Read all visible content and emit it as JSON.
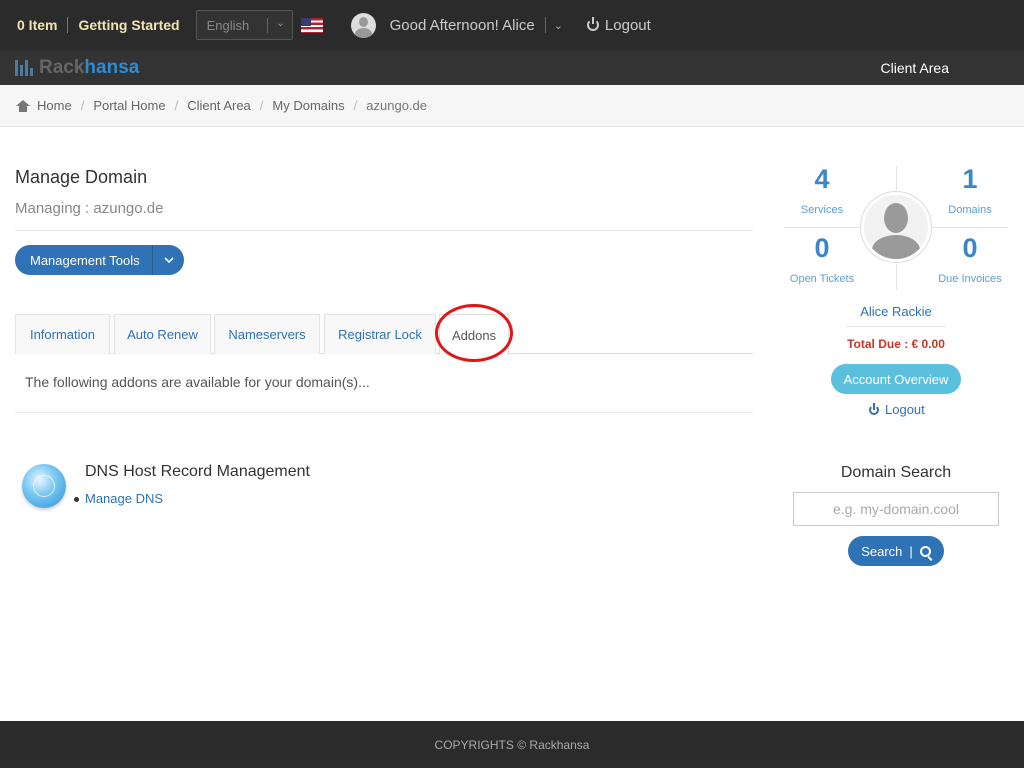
{
  "topbar": {
    "cart_label": "0 Item",
    "getting_started": "Getting Started",
    "language": "English",
    "greeting": "Good Afternoon! Alice",
    "logout": "Logout"
  },
  "brand": {
    "logo_part1": "Rack",
    "logo_part2": "hansa",
    "nav_client_area": "Client Area"
  },
  "breadcrumb": {
    "items": [
      "Home",
      "Portal Home",
      "Client Area",
      "My Domains"
    ],
    "current": "azungo.de"
  },
  "main": {
    "title": "Manage Domain",
    "subtitle": "Managing : azungo.de",
    "management_tools": "Management Tools",
    "tabs": [
      {
        "label": "Information"
      },
      {
        "label": "Auto Renew"
      },
      {
        "label": "Nameservers"
      },
      {
        "label": "Registrar Lock"
      },
      {
        "label": "Addons"
      }
    ],
    "active_tab": "Addons",
    "tab_content_text": "The following addons are available for your domain(s)...",
    "addon": {
      "title": "DNS Host Record Management",
      "link": "Manage DNS"
    }
  },
  "sidebar": {
    "stats": [
      {
        "value": "4",
        "label": "Services"
      },
      {
        "value": "1",
        "label": "Domains"
      },
      {
        "value": "0",
        "label": "Open Tickets"
      },
      {
        "value": "0",
        "label": "Due Invoices"
      }
    ],
    "user_name": "Alice Rackie",
    "total_due": "Total Due : € 0.00",
    "account_overview": "Account Overview",
    "logout": "Logout",
    "domain_search": {
      "title": "Domain Search",
      "placeholder": "e.g. my-domain.cool",
      "button": "Search",
      "button_sep": "|"
    }
  },
  "footer": {
    "copyright": "COPYRIGHTS © Rackhansa"
  },
  "colors": {
    "accent": "#2f72b5",
    "info_button": "#5bc0de",
    "topbar_bg": "#2b2b2b",
    "highlight_circle": "#e01515"
  }
}
